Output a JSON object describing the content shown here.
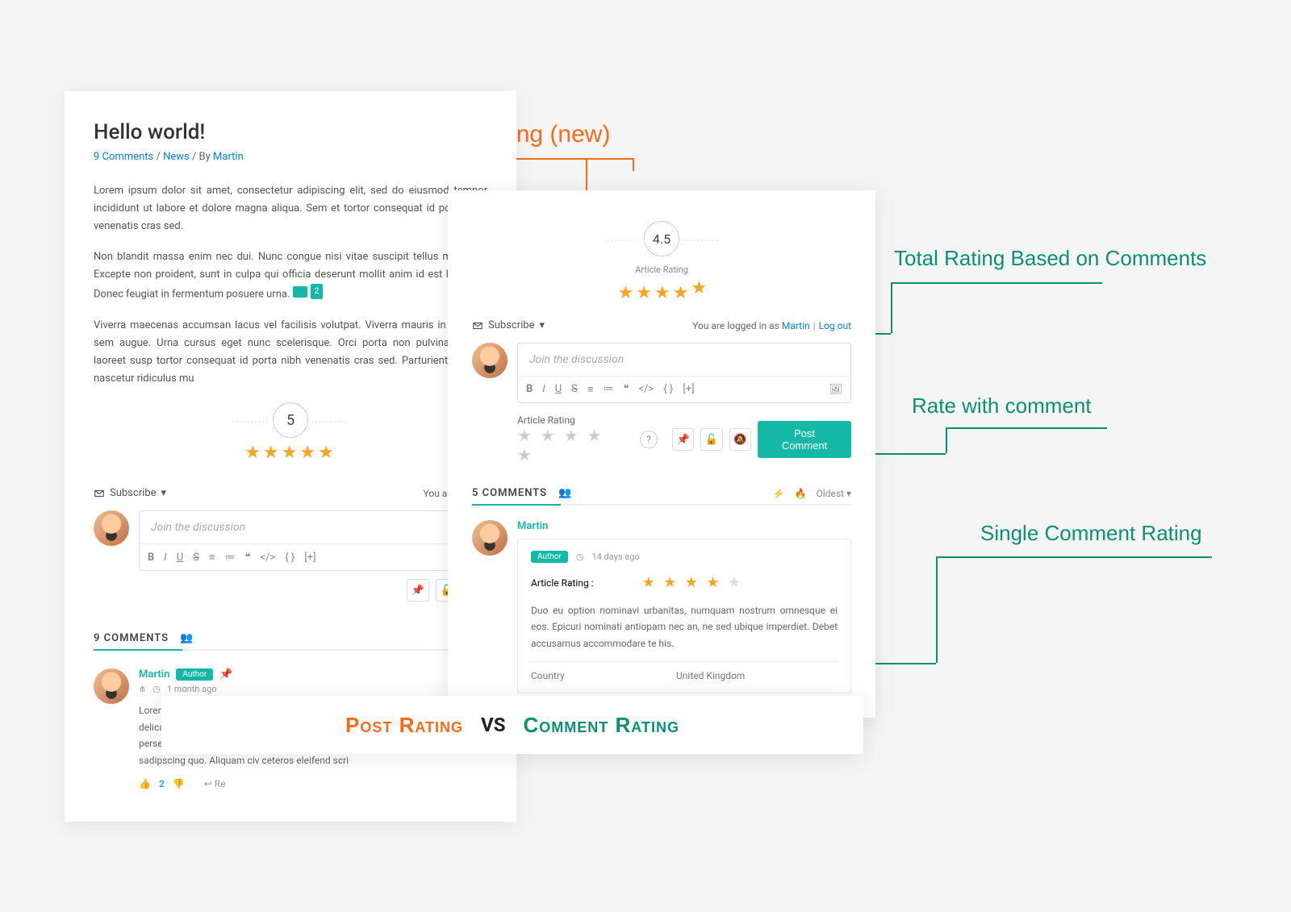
{
  "annotations": {
    "post_rating": "Post Rating (new)",
    "total_rating": "Total Rating Based on Comments",
    "rate_with": "Rate with comment",
    "single_rating": "Single Comment Rating",
    "bottom_left": "Post Rating",
    "bottom_vs": "VS",
    "bottom_right": "Comment Rating"
  },
  "left": {
    "title": "Hello world!",
    "meta_comments": "9 Comments",
    "meta_sep1": " / ",
    "meta_cat": "News",
    "meta_sep2": " / By ",
    "meta_author": "Martin",
    "para1": "Lorem ipsum dolor sit amet, consectetur adipiscing elit, sed do eiusmod tempor incididunt ut labore et dolore magna aliqua.  Sem et tortor consequat id porta nibh venenatis cras sed.",
    "para2a": "Non blandit massa enim nec dui. Nunc congue nisi vitae suscipit tellus mauris a. Excepte non proident, sunt in culpa qui officia deserunt mollit anim id est laborum. Donec feugiat in fermentum posuere urna.",
    "speech_count": "2",
    "para3": "Viverra maecenas accumsan lacus vel facilisis volutpat. Viverra mauris in aliquam sem augue. Urna cursus eget nunc scelerisque. Orci porta non pulvinar neque laoreet susp tortor consequat id porta nibh venenatis cras sed. Parturient montes nascetur ridiculus mu",
    "rating_value": "5",
    "subscribe": "Subscribe",
    "logged_in": "You are logged",
    "placeholder": "Join the discussion",
    "comments_count": "9 COMMENTS",
    "commenter": "Martin",
    "author_badge": "Author",
    "comment_time": "1 month ago",
    "comment_text": "Lorem ipsum dolor sit amet, ea tantas molestiae vis, an qui repudiandae delicatissim equidem fabulas in, agam omnium quidam eos te, salutatus persecuti forensibus vim contentiones mea. Quem pertinax mel no, eu audire sadipscing quo. Aliquam civ ceteros eleifend scri",
    "vote_count": "2",
    "reply": "Re"
  },
  "right": {
    "rating_value": "4.5",
    "rating_label": "Article Rating",
    "subscribe": "Subscribe",
    "logged_prefix": "You are logged in as ",
    "logged_user": "Martin",
    "logout": "Log out",
    "placeholder": "Join the discussion",
    "rate_label": "Article Rating",
    "post_comment": "Post Comment",
    "comments_count": "5 COMMENTS",
    "sort": "Oldest",
    "commenter": "Martin",
    "author_badge": "Author",
    "comment_time": "14 days ago",
    "rating_row_label": "Article Rating :",
    "comment_text": "Duo eu option nominavi urbanitas, numquam nostrum omnesque ei eos. Epicuri nominati antiopam nec an, ne sed ubique imperdiet. Debet accusamus accommodare te his.",
    "field_name": "Country",
    "field_value": "United Kingdom"
  },
  "editor": {
    "bold": "B",
    "italic": "I",
    "underline": "U",
    "strike": "S",
    "ol": "≡",
    "ul": "≔",
    "quote": "❝",
    "code": "</>",
    "cb": "{ }",
    "more": "[+]",
    "image": "🖼"
  }
}
